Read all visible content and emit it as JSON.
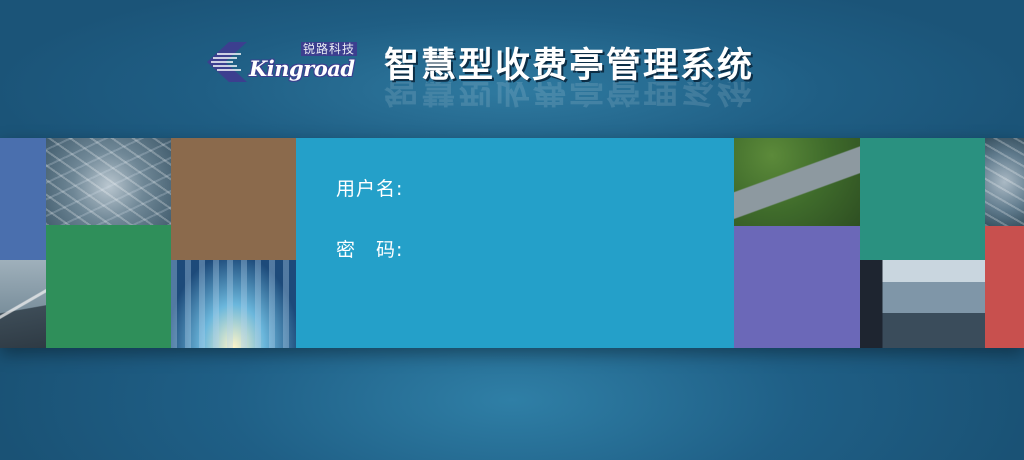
{
  "header": {
    "logo_en": "Kingroad",
    "logo_cn": "锐路科技",
    "title": "智慧型收费亭管理系统"
  },
  "login": {
    "username_label": "用户名:",
    "password_label": "密　码:",
    "username_value": "",
    "password_value": ""
  },
  "colors": {
    "background": "#1f5f86",
    "form_panel": "#24a0c9",
    "tile_blue": "#4a6fae",
    "tile_green": "#2f8f5a",
    "tile_brown": "#8b6a4c",
    "tile_purple": "#6b68b8",
    "tile_teal": "#2a9180",
    "tile_red": "#c8504e"
  }
}
